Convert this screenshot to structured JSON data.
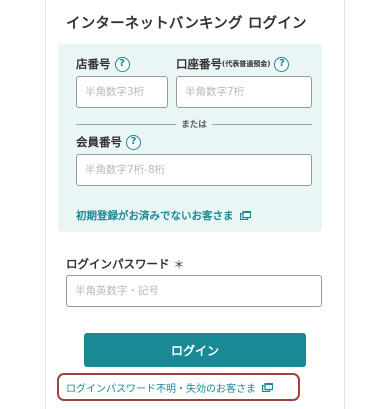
{
  "login": {
    "title": "インターネットバンキング ログイン",
    "branch": {
      "label": "店番号",
      "placeholder": "半角数字3桁"
    },
    "account": {
      "label": "口座番号",
      "sub_label": "(代表普通預金)",
      "placeholder": "半角数字7桁"
    },
    "separator": "または",
    "member": {
      "label": "会員番号",
      "placeholder": "半角数字7桁-8桁"
    },
    "first_time_link": "初期登録がお済みでないお客さま",
    "password": {
      "label": "ログインパスワード",
      "required_mark": "＊",
      "placeholder": "半角英数字・記号"
    },
    "login_button": "ログイン",
    "forgot_link": "ログインパスワード不明・失効のお客さま",
    "help_glyph": "?"
  },
  "colors": {
    "accent": "#1a8996",
    "panel_bg": "#eaf5f6",
    "highlight_border": "#a0443a"
  },
  "icons": {
    "help": "question-circle-icon",
    "external": "new-window-icon"
  }
}
